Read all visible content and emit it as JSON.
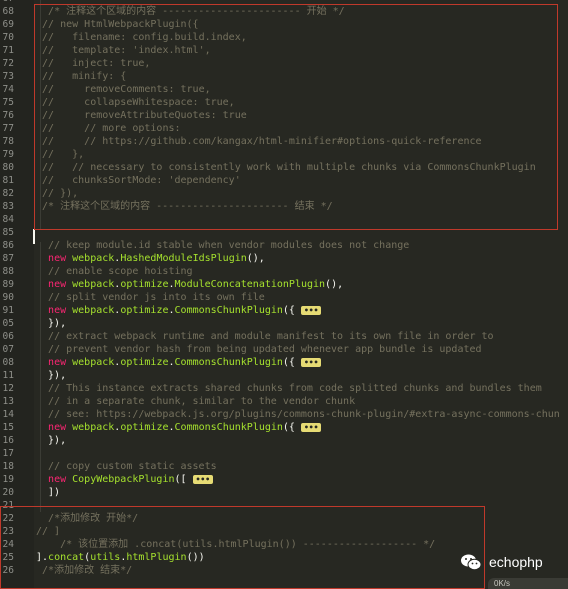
{
  "editor": {
    "lines": [
      {
        "ln": "67",
        "html": ""
      },
      {
        "ln": "68",
        "html": "  <span class=\"c\">/* 注释这个区域的内容 ----------------------- 开始 */</span>"
      },
      {
        "ln": "69",
        "html": " <span class=\"c\">// new HtmlWebpackPlugin({</span>"
      },
      {
        "ln": "70",
        "html": " <span class=\"c\">//   filename: config.build.index,</span>"
      },
      {
        "ln": "71",
        "html": " <span class=\"c\">//   template: 'index.html',</span>"
      },
      {
        "ln": "72",
        "html": " <span class=\"c\">//   inject: true,</span>"
      },
      {
        "ln": "73",
        "html": " <span class=\"c\">//   minify: {</span>"
      },
      {
        "ln": "74",
        "html": " <span class=\"c\">//     removeComments: true,</span>"
      },
      {
        "ln": "75",
        "html": " <span class=\"c\">//     collapseWhitespace: true,</span>"
      },
      {
        "ln": "76",
        "html": " <span class=\"c\">//     removeAttributeQuotes: true</span>"
      },
      {
        "ln": "77",
        "html": " <span class=\"c\">//     // more options:</span>"
      },
      {
        "ln": "78",
        "html": " <span class=\"c\">//     // https://github.com/kangax/html-minifier#options-quick-reference</span>"
      },
      {
        "ln": "79",
        "html": " <span class=\"c\">//   },</span>"
      },
      {
        "ln": "80",
        "html": " <span class=\"c\">//   // necessary to consistently work with multiple chunks via CommonsChunkPlugin</span>"
      },
      {
        "ln": "81",
        "html": " <span class=\"c\">//   chunksSortMode: 'dependency'</span>"
      },
      {
        "ln": "82",
        "html": " <span class=\"c\">// }),</span>"
      },
      {
        "ln": "83",
        "html": " <span class=\"c\">/* 注释这个区域的内容 ---------------------- 结束 */</span>"
      },
      {
        "ln": "84",
        "html": ""
      },
      {
        "ln": "85",
        "html": ""
      },
      {
        "ln": "86",
        "html": "  <span class=\"c\">// keep module.id stable when vendor modules does not change</span>"
      },
      {
        "ln": "87",
        "html": "  <span class=\"k\">new</span> <span class=\"f\">webpack</span>.<span class=\"f\">HashedModuleIdsPlugin</span>(),"
      },
      {
        "ln": "88",
        "html": "  <span class=\"c\">// enable scope hoisting</span>"
      },
      {
        "ln": "89",
        "html": "  <span class=\"k\">new</span> <span class=\"f\">webpack</span>.<span class=\"f\">optimize</span>.<span class=\"f\">ModuleConcatenationPlugin</span>(),"
      },
      {
        "ln": "90",
        "html": "  <span class=\"c\">// split vendor js into its own file</span>"
      },
      {
        "ln": "91",
        "html": "  <span class=\"k\">new</span> <span class=\"f\">webpack</span>.<span class=\"f\">optimize</span>.<span class=\"f\">CommonsChunkPlugin</span>({ <span class=\"fold\">•••</span>"
      },
      {
        "ln": "05",
        "html": "  }),"
      },
      {
        "ln": "06",
        "html": "  <span class=\"c\">// extract webpack runtime and module manifest to its own file in order to</span>"
      },
      {
        "ln": "07",
        "html": "  <span class=\"c\">// prevent vendor hash from being updated whenever app bundle is updated</span>"
      },
      {
        "ln": "08",
        "html": "  <span class=\"k\">new</span> <span class=\"f\">webpack</span>.<span class=\"f\">optimize</span>.<span class=\"f\">CommonsChunkPlugin</span>({ <span class=\"fold\">•••</span>"
      },
      {
        "ln": "11",
        "html": "  }),"
      },
      {
        "ln": "12",
        "html": "  <span class=\"c\">// This instance extracts shared chunks from code splitted chunks and bundles them</span>"
      },
      {
        "ln": "13",
        "html": "  <span class=\"c\">// in a separate chunk, similar to the vendor chunk</span>"
      },
      {
        "ln": "14",
        "html": "  <span class=\"c\">// see: https://webpack.js.org/plugins/commons-chunk-plugin/#extra-async-commons-chun</span>"
      },
      {
        "ln": "15",
        "html": "  <span class=\"k\">new</span> <span class=\"f\">webpack</span>.<span class=\"f\">optimize</span>.<span class=\"f\">CommonsChunkPlugin</span>({ <span class=\"fold\">•••</span>"
      },
      {
        "ln": "16",
        "html": "  }),"
      },
      {
        "ln": "17",
        "html": ""
      },
      {
        "ln": "18",
        "html": "  <span class=\"c\">// copy custom static assets</span>"
      },
      {
        "ln": "19",
        "html": "  <span class=\"k\">new</span> <span class=\"f\">CopyWebpackPlugin</span>([ <span class=\"fold\">•••</span>"
      },
      {
        "ln": "20",
        "html": "  ])"
      },
      {
        "ln": "21",
        "html": ""
      },
      {
        "ln": "22",
        "html": "  <span class=\"c\">/*添加修改 开始*/</span>"
      },
      {
        "ln": "23",
        "html": "<span class=\"c\">// ]</span>"
      },
      {
        "ln": "24",
        "html": "    <span class=\"c\">/* 该位置添加 .concat(utils.htmlPlugin()) ------------------- */</span>"
      },
      {
        "ln": "25",
        "html": "].<span class=\"f\">concat</span>(<span class=\"f\">utils</span>.<span class=\"f\">htmlPlugin</span>())"
      },
      {
        "ln": "26",
        "html": " <span class=\"c\">/*添加修改 结束*/</span>"
      }
    ]
  },
  "watermark": {
    "text": "echophp"
  },
  "minibar": {
    "text": "0K/s"
  }
}
